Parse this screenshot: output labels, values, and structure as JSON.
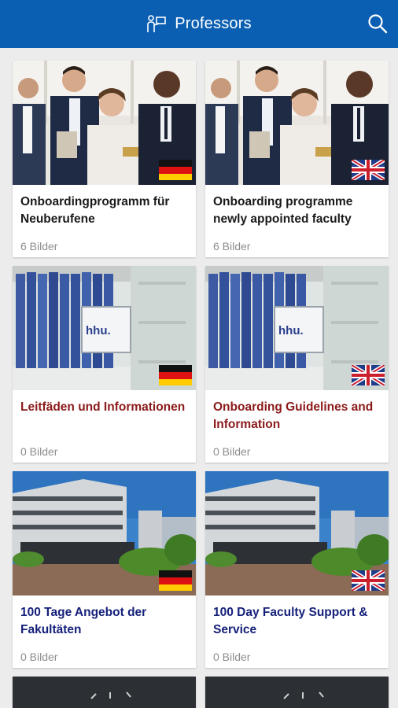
{
  "header": {
    "title": "Professors",
    "title_icon": "people-icon",
    "search_icon": "search-icon",
    "bar_color": "#0b5fb2"
  },
  "cards": [
    {
      "title": "Onboardingprogramm für Neuberufene",
      "count": "6 Bilder",
      "image": "people-photo",
      "flag": "german-flag",
      "title_color": "#1a1a1a"
    },
    {
      "title": "Onboarding programme newly appointed faculty",
      "count": "6 Bilder",
      "image": "people-photo",
      "flag": "uk-flag",
      "title_color": "#1a1a1a"
    },
    {
      "title": "Leitfäden und Informationen",
      "count": "0 Bilder",
      "image": "bookshelf-photo",
      "flag": "german-flag",
      "title_color": "#8b1a1a"
    },
    {
      "title": "Onboarding Guidelines and Information",
      "count": "0 Bilder",
      "image": "bookshelf-photo",
      "flag": "uk-flag",
      "title_color": "#8b1a1a"
    },
    {
      "title": "100 Tage Angebot der Fakultäten",
      "count": "0 Bilder",
      "image": "building-photo",
      "flag": "german-flag",
      "title_color": "#15207a"
    },
    {
      "title": "100 Day Faculty Support & Service",
      "count": "0 Bilder",
      "image": "building-photo",
      "flag": "uk-flag",
      "title_color": "#15207a"
    }
  ],
  "bookshelf_sign": "hhu."
}
